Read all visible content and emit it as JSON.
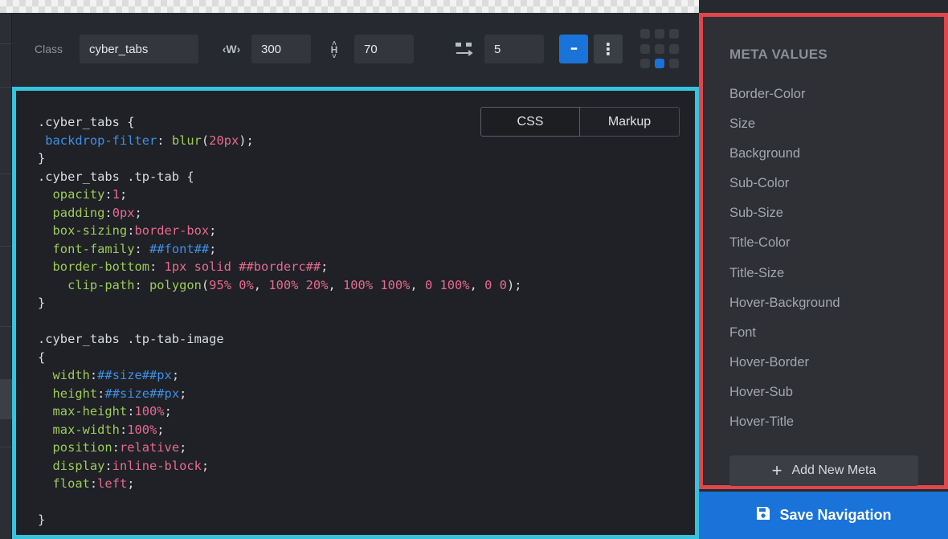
{
  "toolbar": {
    "class_label": "Class",
    "class_value": "cyber_tabs",
    "width_icon_glyph": "‹W›",
    "width_value": "300",
    "height_icon_glyph": "H",
    "height_value": "70",
    "spacing_value": "5",
    "more_horizontal_glyph": "•••",
    "more_vertical_glyph": "⋮"
  },
  "editor": {
    "tabs": [
      "CSS",
      "Markup"
    ],
    "active_tab": "CSS",
    "code_lines": [
      [
        [
          ".cyber_tabs {",
          "w"
        ]
      ],
      [
        [
          " backdrop-filter",
          "b"
        ],
        [
          ": ",
          "w"
        ],
        [
          "blur",
          "k"
        ],
        [
          "(",
          "w"
        ],
        [
          "20px",
          "v"
        ],
        [
          ");",
          "w"
        ]
      ],
      [
        [
          "}",
          "w"
        ]
      ],
      [
        [
          ".cyber_tabs .tp-tab {",
          "w"
        ]
      ],
      [
        [
          "  opacity",
          "k"
        ],
        [
          ":",
          "w"
        ],
        [
          "1",
          "v"
        ],
        [
          ";",
          "w"
        ]
      ],
      [
        [
          "  padding",
          "k"
        ],
        [
          ":",
          "w"
        ],
        [
          "0px",
          "v"
        ],
        [
          ";",
          "w"
        ]
      ],
      [
        [
          "  box-sizing",
          "k"
        ],
        [
          ":",
          "w"
        ],
        [
          "border-box",
          "v"
        ],
        [
          ";",
          "w"
        ]
      ],
      [
        [
          "  font-family",
          "k"
        ],
        [
          ": ",
          "w"
        ],
        [
          "##font##",
          "b"
        ],
        [
          ";",
          "w"
        ]
      ],
      [
        [
          "  border-bottom",
          "k"
        ],
        [
          ": ",
          "w"
        ],
        [
          "1px solid",
          "v"
        ],
        [
          " ",
          "w"
        ],
        [
          "##borderc##",
          "v"
        ],
        [
          ";",
          "w"
        ]
      ],
      [
        [
          "    clip-path",
          "k"
        ],
        [
          ": ",
          "w"
        ],
        [
          "polygon",
          "k"
        ],
        [
          "(",
          "w"
        ],
        [
          "95% 0%",
          "v"
        ],
        [
          ", ",
          "w"
        ],
        [
          "100% 20%",
          "v"
        ],
        [
          ", ",
          "w"
        ],
        [
          "100% 100%",
          "v"
        ],
        [
          ", ",
          "w"
        ],
        [
          "0 100%",
          "v"
        ],
        [
          ", ",
          "w"
        ],
        [
          "0 0",
          "v"
        ],
        [
          ");",
          "w"
        ]
      ],
      [
        [
          "}",
          "w"
        ]
      ],
      [
        [
          "",
          "w"
        ]
      ],
      [
        [
          ".cyber_tabs .tp-tab-image",
          "w"
        ]
      ],
      [
        [
          "{",
          "w"
        ]
      ],
      [
        [
          "  width",
          "k"
        ],
        [
          ":",
          "w"
        ],
        [
          "##size##px",
          "b"
        ],
        [
          ";",
          "w"
        ]
      ],
      [
        [
          "  height",
          "k"
        ],
        [
          ":",
          "w"
        ],
        [
          "##size##px",
          "b"
        ],
        [
          ";",
          "w"
        ]
      ],
      [
        [
          "  max-height",
          "k"
        ],
        [
          ":",
          "w"
        ],
        [
          "100%",
          "v"
        ],
        [
          ";",
          "w"
        ]
      ],
      [
        [
          "  max-width",
          "k"
        ],
        [
          ":",
          "w"
        ],
        [
          "100%",
          "v"
        ],
        [
          ";",
          "w"
        ]
      ],
      [
        [
          "  position",
          "k"
        ],
        [
          ":",
          "w"
        ],
        [
          "relative",
          "v"
        ],
        [
          ";",
          "w"
        ]
      ],
      [
        [
          "  display",
          "k"
        ],
        [
          ":",
          "w"
        ],
        [
          "inline-block",
          "v"
        ],
        [
          ";",
          "w"
        ]
      ],
      [
        [
          "  float",
          "k"
        ],
        [
          ":",
          "w"
        ],
        [
          "left",
          "v"
        ],
        [
          ";",
          "w"
        ]
      ],
      [
        [
          "",
          "w"
        ]
      ],
      [
        [
          "}",
          "w"
        ]
      ]
    ]
  },
  "meta": {
    "title": "META VALUES",
    "items": [
      "Border-Color",
      "Size",
      "Background",
      "Sub-Color",
      "Sub-Size",
      "Title-Color",
      "Title-Size",
      "Hover-Background",
      "Font",
      "Hover-Border",
      "Hover-Sub",
      "Hover-Title"
    ],
    "add_label": "Add New Meta"
  },
  "save": {
    "label": "Save Navigation"
  },
  "colors": {
    "accent_blue": "#1a73d9",
    "editor_highlight": "#35c3de",
    "meta_highlight": "#e0464b",
    "code_property": "#9ecb5a",
    "code_value": "#e76a8f",
    "code_variable": "#3f8fe6"
  }
}
